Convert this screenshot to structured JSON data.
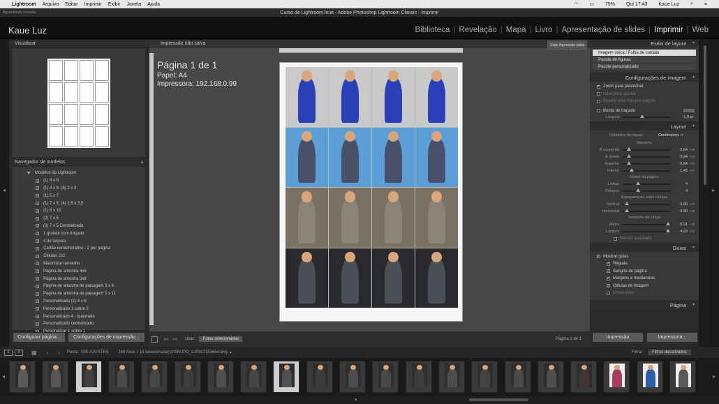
{
  "menubar": {
    "apple": "",
    "items": [
      "Lightroom",
      "Arquivo",
      "Editar",
      "Imprimir",
      "Exibir",
      "Janela",
      "Ajuda"
    ],
    "battery": "75%",
    "clock": "Qui 17:43",
    "user": "Kaue Luz"
  },
  "window": {
    "title": "Curso de Lightroom.lrcat - Adobe Photoshop Lightroom Classic - Imprimir",
    "status": "Aguardando conexão"
  },
  "identity": "Kaue Luz",
  "modules": [
    "Biblioteca",
    "Revelação",
    "Mapa",
    "Livro",
    "Apresentação de slides",
    "Imprimir",
    "Web"
  ],
  "active_module": "Imprimir",
  "left_panel": {
    "preview_title": "Visualizar",
    "templates_title": "Navegador de modelos",
    "templates_add": "+",
    "folder": "Modelos do Lightroom",
    "templates": [
      "(1) 4 x 6",
      "(1) 4 x 6, (6) 2 x 3",
      "(1) 5 x 7",
      "(1) 7 x 5, (4) 2,5 x 3,5",
      "(1) 8 x 10",
      "(2) 7 x 5",
      "(2) 7 x 5 Centralizado",
      "1 grande com traçado",
      "4 de largura",
      "Cartão comemorativo - 2 por página",
      "Células 2x2",
      "Maximizar tamanho",
      "Página de amostra 4x5",
      "Página de amostra 5x8",
      "Página de amostra de paisagem 5 x 9",
      "Página de amostra de paisagem 5 x 11",
      "Personalizado (2) 4 x 6",
      "Personalizado 1 sobre 2",
      "Personalizado 4 - quadrado",
      "Personalizado centralizado",
      "Personalizar 1 sobre 1"
    ],
    "btn_page": "Configurar página...",
    "btn_print_settings": "Configurações de impressão..."
  },
  "center": {
    "header": "Impressão não salva",
    "create_btn": "Criar Impressão salva",
    "page_title": "Página 1 de 1",
    "paper": "Papel:  A4",
    "printer": "Impressora:  192.168.0.99",
    "toolbar_use_label": "Usar:",
    "toolbar_use_value": "Fotos selecionadas",
    "page_counter": "Página 1 de 1"
  },
  "right_panel": {
    "layout_style_title": "Estilo de layout",
    "layout_styles": [
      "Imagem única / Folha de contato",
      "Pacote de figuras",
      "Pacote personalizado"
    ],
    "image_settings_title": "Configurações de imagem",
    "image_settings": [
      {
        "label": "Zoom para preencher",
        "checked": true,
        "dim": false
      },
      {
        "label": "Girar para ajustar",
        "checked": false,
        "dim": true
      },
      {
        "label": "Repetir uma foto por página",
        "checked": false,
        "dim": true
      }
    ],
    "stroke_label": "Borda de traçado",
    "stroke_width_label": "Largura",
    "stroke_width_value": "1,0 pt",
    "layout_title": "Layout",
    "ruler_units_label": "Unidades da régua:",
    "ruler_units_value": "Centímetros",
    "margins_title": "Margens",
    "margins": [
      {
        "label": "À esquerda",
        "value": "0,64",
        "unit": "cm",
        "pos": 0.05
      },
      {
        "label": "À direita",
        "value": "0,64",
        "unit": "cm",
        "pos": 0.05
      },
      {
        "label": "Superior",
        "value": "0,64",
        "unit": "cm",
        "pos": 0.05
      },
      {
        "label": "Inferior",
        "value": "1,45",
        "unit": "cm",
        "pos": 0.12
      }
    ],
    "grid_title": "Grade da página",
    "grid": [
      {
        "label": "Linhas",
        "value": "4",
        "unit": "",
        "pos": 0.27
      },
      {
        "label": "Colunas",
        "value": "4",
        "unit": "",
        "pos": 0.27
      }
    ],
    "spacing_title": "Espaçamento entre células",
    "spacing": [
      {
        "label": "Vertical",
        "value": "0,00",
        "unit": "cm",
        "pos": 0.0
      },
      {
        "label": "Horizontal",
        "value": "0,00",
        "unit": "cm",
        "pos": 0.0
      }
    ],
    "cellsize_title": "Tamanho da célula",
    "cellsize": [
      {
        "label": "Altura",
        "value": "6,91",
        "unit": "cm",
        "pos": 0.98
      },
      {
        "label": "Largura",
        "value": "4,93",
        "unit": "cm",
        "pos": 0.98
      }
    ],
    "keep_square": "Manter quadrado",
    "guides_title": "Guias",
    "show_guides": "Mostrar guias",
    "guides": [
      {
        "label": "Réguas",
        "checked": true
      },
      {
        "label": "Sangria de página",
        "checked": true
      },
      {
        "label": "Margens e medianizes",
        "checked": true
      },
      {
        "label": "Células de imagem",
        "checked": true
      },
      {
        "label": "Dimensões",
        "checked": false
      }
    ],
    "page_title": "Página",
    "btn_print": "Impressão",
    "btn_printer": "Impressora..."
  },
  "filmstrip": {
    "page_buttons": [
      "1",
      "2"
    ],
    "source": "Pasta : 005-AJUSTES",
    "count": "246 fotos",
    "selected": "16 selecionada(s)",
    "filename": "/GRUPO_120307153654.dng",
    "filter_label": "Filtrar:",
    "filter_value": "Filtros desativados"
  },
  "colors": {
    "accent_blue": "#2b3fb8",
    "sky_blue": "#5b9fd6",
    "neutral_gray": "#8a8478",
    "dark_fur": "#4b4f57"
  }
}
